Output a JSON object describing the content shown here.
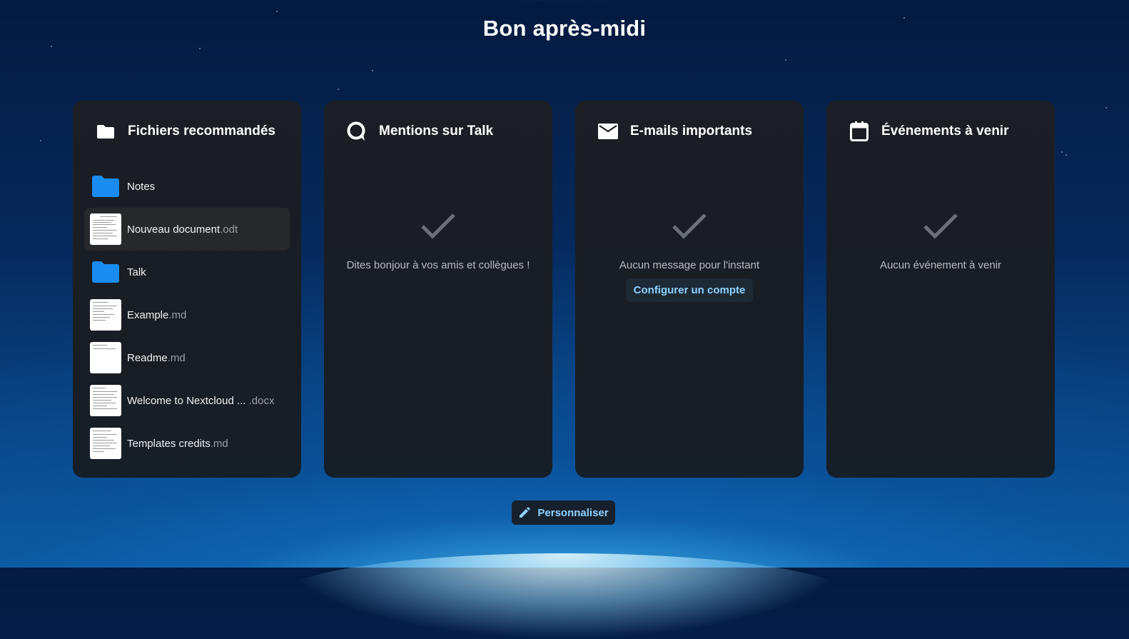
{
  "greeting": "Bon après-midi",
  "colors": {
    "accent_text": "#8fd0ff",
    "folder": "#1a8cf0",
    "panel_bg": "#1b1e24"
  },
  "panels": [
    {
      "title": "Fichiers recommandés",
      "icon": "folder-icon",
      "files": [
        {
          "name": "Notes",
          "ext": "",
          "kind": "folder"
        },
        {
          "name": "Nouveau document",
          "ext": ".odt",
          "kind": "document",
          "selected": true
        },
        {
          "name": "Talk",
          "ext": "",
          "kind": "folder"
        },
        {
          "name": "Example",
          "ext": ".md",
          "kind": "document"
        },
        {
          "name": "Readme",
          "ext": ".md",
          "kind": "document"
        },
        {
          "name": "Welcome to Nextcloud ... ",
          "ext": ".docx",
          "kind": "document"
        },
        {
          "name": "Templates credits",
          "ext": ".md",
          "kind": "document"
        }
      ]
    },
    {
      "title": "Mentions sur Talk",
      "icon": "talk-icon",
      "empty_text": "Dites bonjour à vos amis et collègues !"
    },
    {
      "title": "E-mails importants",
      "icon": "mail-icon",
      "empty_text": "Aucun message pour l'instant",
      "button": "Configurer un compte"
    },
    {
      "title": "Événements à venir",
      "icon": "calendar-icon",
      "empty_text": "Aucun événement à venir"
    }
  ],
  "customize_button": "Personnaliser"
}
